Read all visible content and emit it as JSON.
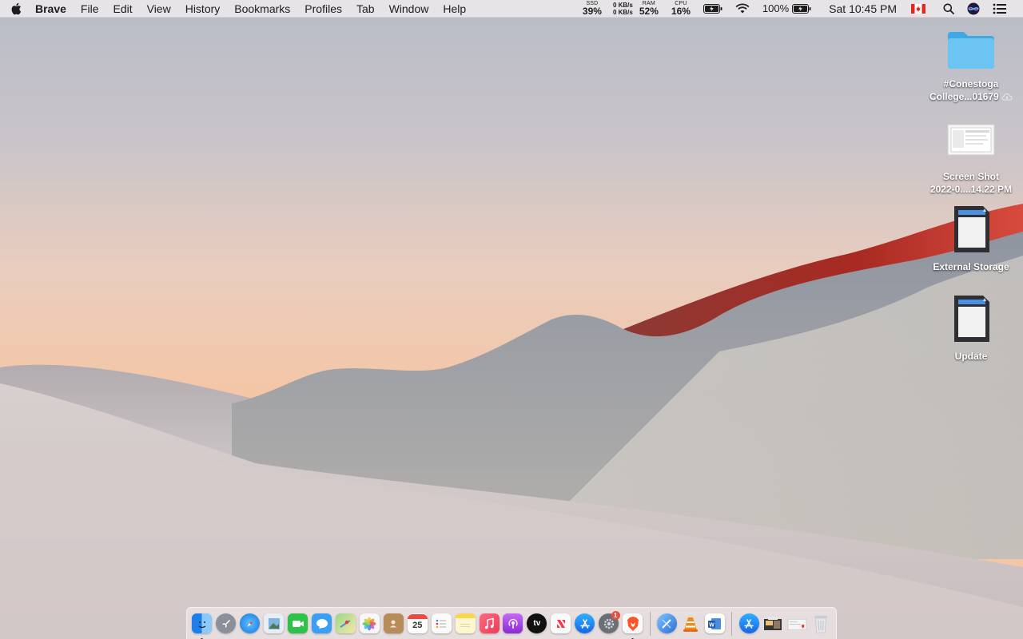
{
  "menubar": {
    "apple_icon": "apple-icon",
    "app_name": "Brave",
    "menus": [
      "File",
      "Edit",
      "View",
      "History",
      "Bookmarks",
      "Profiles",
      "Tab",
      "Window",
      "Help"
    ],
    "ssd_label": "SSD",
    "ssd_value": "39%",
    "net_up": "0 KB/s",
    "net_down": "0 KB/s",
    "ram_label": "RAM",
    "ram_value": "52%",
    "cpu_label": "CPU",
    "cpu_value": "16%",
    "battery_percent": "100%",
    "clock": "Sat 10:45 PM",
    "flag": "canada-flag-icon",
    "icons": [
      "battery-charging-icon",
      "wifi-icon",
      "battery-icon",
      "search-icon",
      "siri-icon",
      "control-center-icon"
    ]
  },
  "desktop": {
    "icons": [
      {
        "label_line1": "#Conestoga",
        "label_line2": "College...01679",
        "icon": "folder-icon",
        "status_icon": "icloud-icon"
      },
      {
        "label_line1": "Screen Shot",
        "label_line2": "2022-0....14.22 PM",
        "icon": "screenshot-thumbnail-icon"
      },
      {
        "label_line1": "External Storage",
        "icon": "sd-card-icon"
      },
      {
        "label_line1": "Update",
        "icon": "sd-card-icon"
      }
    ]
  },
  "dock": {
    "calendar_day": "25",
    "system_prefs_badge": "1",
    "apps": [
      {
        "name": "finder-icon",
        "color": "#2a8cf2",
        "running": true
      },
      {
        "name": "launchpad-icon",
        "color": "#8a8f99"
      },
      {
        "name": "safari-icon",
        "color": "#1a8fe8"
      },
      {
        "name": "preview-icon",
        "color": "#5fa0d6"
      },
      {
        "name": "facetime-icon",
        "color": "#2fc24a"
      },
      {
        "name": "messages-icon",
        "color": "#3aa0f5"
      },
      {
        "name": "maps-icon",
        "color": "#7cc27a"
      },
      {
        "name": "photos-icon",
        "color": "#f7f7f7"
      },
      {
        "name": "contacts-icon",
        "color": "#b78b5a"
      },
      {
        "name": "calendar-icon",
        "color": "#ffffff"
      },
      {
        "name": "reminders-icon",
        "color": "#f7f7f7"
      },
      {
        "name": "notes-icon",
        "color": "#f8d84a"
      },
      {
        "name": "music-icon",
        "color": "#f5506a"
      },
      {
        "name": "podcasts-icon",
        "color": "#9c3fe0"
      },
      {
        "name": "apple-tv-icon",
        "color": "#1a1a1a"
      },
      {
        "name": "news-icon",
        "color": "#f7f7f7"
      },
      {
        "name": "app-store-icon",
        "color": "#1e8ef5"
      },
      {
        "name": "system-preferences-icon",
        "color": "#6b6f76"
      },
      {
        "name": "brave-icon",
        "color": "#fb542b",
        "running": true
      },
      {
        "name": "xcode-icon",
        "color": "#3d8de8"
      },
      {
        "name": "vlc-icon",
        "color": "#f08a1c"
      },
      {
        "name": "word-icon",
        "color": "#2b5fb8"
      },
      {
        "name": "app-store-folder-icon",
        "color": "#1e8ef5"
      },
      {
        "name": "image-capture-icon",
        "color": "#6a5a4a"
      },
      {
        "name": "mail-stack-icon",
        "color": "#efefef"
      },
      {
        "name": "trash-icon",
        "color": "#d8dadd"
      }
    ]
  }
}
